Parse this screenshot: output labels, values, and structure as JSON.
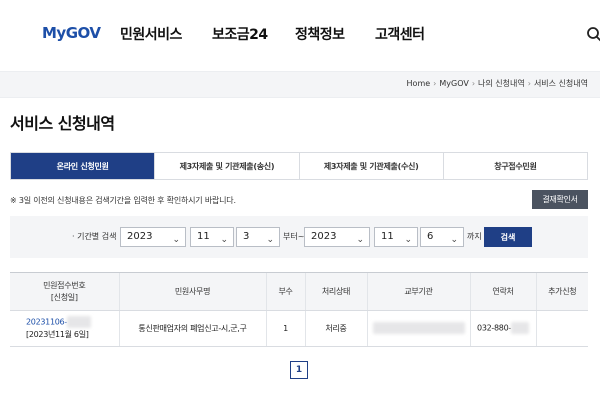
{
  "header": {
    "logo": "MyGOV",
    "nav": [
      "민원서비스",
      "보조금24",
      "정책정보",
      "고객센터"
    ]
  },
  "breadcrumb": [
    "Home",
    "MyGOV",
    "나의 신청내역",
    "서비스 신청내역"
  ],
  "page_title": "서비스 신청내역",
  "tabs": [
    {
      "label": "온라인 신청민원",
      "active": true
    },
    {
      "label": "제3자제출 및 기관제출(송신)",
      "active": false
    },
    {
      "label": "제3자제출 및 기관제출(수신)",
      "active": false
    },
    {
      "label": "창구접수민원",
      "active": false
    }
  ],
  "notice": "※ 3일 이전의 신청내용은 검색기간을 입력한 후 확인하시기 바랍니다.",
  "confirm_button": "결재확인서",
  "filter": {
    "label": "· 기간별 검색",
    "from_year": "2023",
    "from_month": "11",
    "from_day": "3",
    "between": "부터~",
    "to_year": "2023",
    "to_month": "11",
    "to_day": "6",
    "until": "까지",
    "search_button": "검색"
  },
  "table": {
    "headers": {
      "receipt_no": "민원접수번호",
      "receipt_sub": "[신청일]",
      "affair": "민원사무명",
      "copies": "부수",
      "status": "처리상태",
      "agency": "교부기관",
      "contact": "연락처",
      "extra": "추가신청"
    },
    "rows": [
      {
        "receipt_no": "20231106-",
        "date": "[2023년11월 6일]",
        "affair": "통신판매업자의 폐업신고-시,군,구",
        "copies": "1",
        "status": "처리중",
        "agency": "",
        "contact": "032-880-",
        "extra": ""
      }
    ]
  },
  "pagination": {
    "current": "1"
  },
  "colors": {
    "primary": "#1f3f86",
    "logo": "#1d4fa8",
    "dark_button": "#4b5360"
  }
}
